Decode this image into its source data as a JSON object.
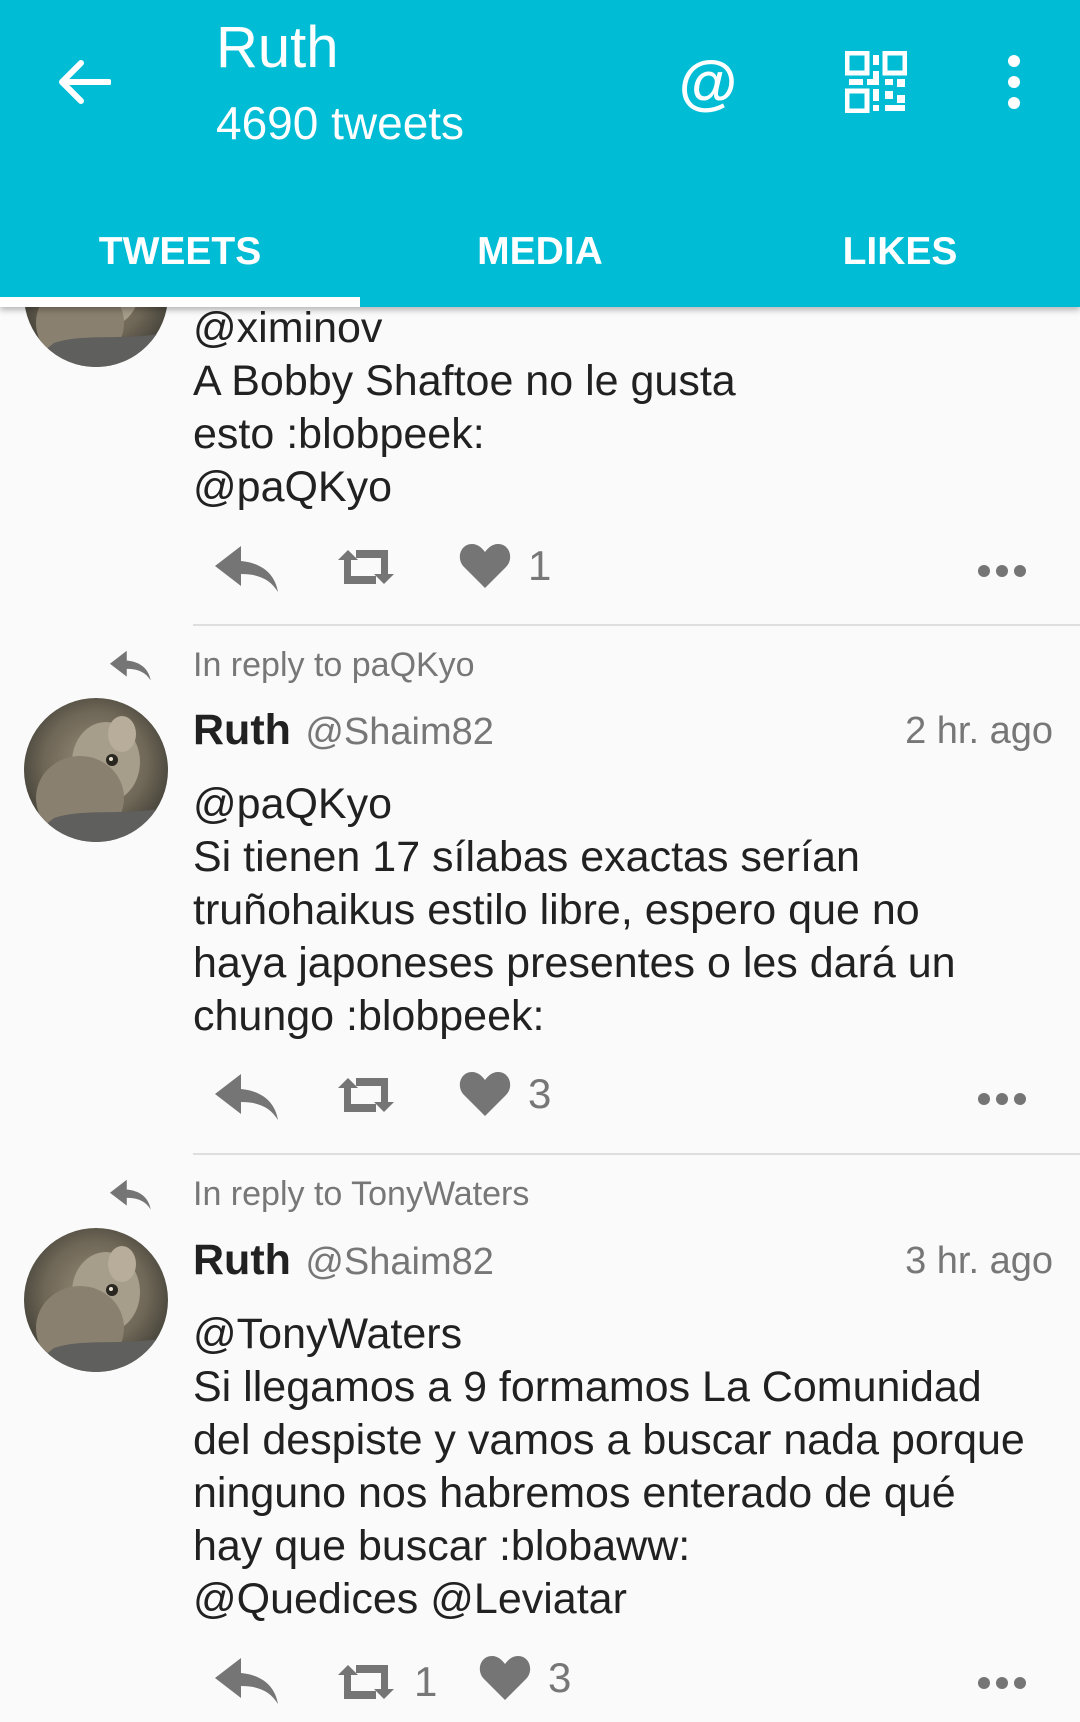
{
  "app": {
    "title": "Ruth",
    "subtitle": "4690 tweets",
    "actions": [
      "at-mention",
      "qr-code",
      "more-options"
    ],
    "accent_color": "#00bcd4",
    "tabs": [
      {
        "label": "TWEETS",
        "selected": true
      },
      {
        "label": "MEDIA",
        "selected": false
      },
      {
        "label": "LIKES",
        "selected": false
      }
    ]
  },
  "tweets": [
    {
      "lines": [
        "@ximinov",
        "A Bobby Shaftoe no le gusta",
        "esto :blobpeek:",
        "@paQKyo"
      ],
      "likes": "1"
    },
    {
      "reply_to": "In reply to paQKyo",
      "name": "Ruth",
      "handle": "@Shaim82",
      "time": "2 hr. ago",
      "lines": [
        "@paQKyo",
        "Si tienen 17 sílabas exactas serían",
        "truñohaikus estilo libre, espero que no",
        "haya japoneses presentes o les dará un",
        "chungo :blobpeek:"
      ],
      "likes": "3"
    },
    {
      "reply_to": "In reply to TonyWaters",
      "name": "Ruth",
      "handle": "@Shaim82",
      "time": "3 hr. ago",
      "lines": [
        "@TonyWaters",
        "Si llegamos a 9 formamos La Comunidad",
        "del despiste y vamos a buscar nada porque",
        "ninguno nos habremos enterado de qué",
        "hay que buscar :blobaww:",
        "@Quedices @Leviatar"
      ],
      "retweets": "1",
      "likes": "3"
    }
  ]
}
